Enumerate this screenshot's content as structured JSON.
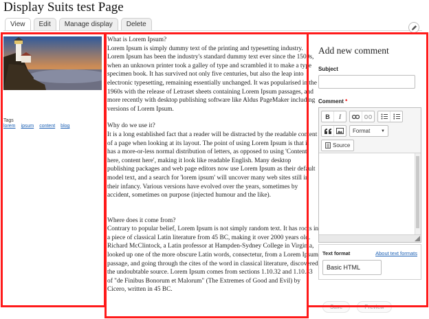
{
  "page": {
    "title": "Display Suits test Page"
  },
  "tabs": [
    {
      "label": "View",
      "active": true
    },
    {
      "label": "Edit"
    },
    {
      "label": "Manage display"
    },
    {
      "label": "Delete"
    }
  ],
  "sidebar": {
    "image_alt": "lighthouse at sunset",
    "tags_label": "Tags",
    "tags": [
      "lorem",
      "ipsum",
      "content",
      "blog"
    ]
  },
  "article": {
    "paragraphs": [
      "What is Lorem Ipsum?",
      "Lorem Ipsum is simply dummy text of the printing and typesetting industry. Lorem Ipsum has been the industry's standard dummy text ever since the 1500s, when an unknown printer took a galley of type and scrambled it to make a type specimen book. It has survived not only five centuries, but also the leap into electronic typesetting, remaining essentially unchanged. It was popularised in the 1960s with the release of Letraset sheets containing Lorem Ipsum passages, and more recently with desktop publishing software like Aldus PageMaker including versions of Lorem Ipsum.",
      "Why do we use it?",
      "It is a long established fact that a reader will be distracted by the readable content of a page when looking at its layout. The point of using Lorem Ipsum is that it has a more-or-less normal distribution of letters, as opposed to using 'Content here, content here', making it look like readable English. Many desktop publishing packages and web page editors now use Lorem Ipsum as their default model text, and a search for 'lorem ipsum' will uncover many web sites still in their infancy. Various versions have evolved over the years, sometimes by accident, sometimes on purpose (injected humour and the like).",
      "Where does it come from?",
      "Contrary to popular belief, Lorem Ipsum is not simply random text. It has roots in a piece of classical Latin literature from 45 BC, making it over 2000 years old. Richard McClintock, a Latin professor at Hampden-Sydney College in Virginia, looked up one of the more obscure Latin words, consectetur, from a Lorem Ipsum passage, and going through the cites of the word in classical literature, discovered the undoubtable source. Lorem Ipsum comes from sections 1.10.32 and 1.10.33 of \"de Finibus Bonorum et Malorum\" (The Extremes of Good and Evil) by Cicero, written in 45 BC."
    ]
  },
  "comment_form": {
    "title": "Add new comment",
    "subject_label": "Subject",
    "subject_value": "",
    "comment_label": "Comment",
    "required_mark": "*",
    "toolbar": {
      "bold": "B",
      "italic": "I",
      "format_label": "Format",
      "source_label": "Source"
    },
    "text_format_label": "Text format",
    "about_formats_link": "About text formats",
    "text_format_value": "Basic HTML",
    "save_label": "Save",
    "preview_label": "Preview"
  },
  "colors": {
    "highlight_border": "#ff1a1a",
    "link": "#1a5fb4",
    "required": "#ee0000"
  }
}
